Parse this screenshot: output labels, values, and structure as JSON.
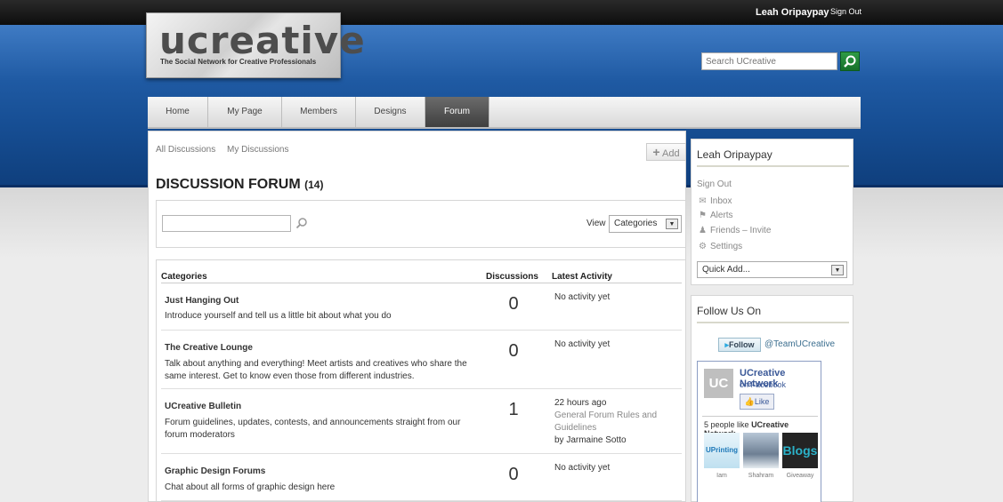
{
  "user": {
    "name": "Leah Oripaypay",
    "sign_out": "Sign Out"
  },
  "logo": {
    "wordmark": "ucreative",
    "tagline": "The Social Network for Creative Professionals"
  },
  "search": {
    "placeholder": "Search UCreative"
  },
  "nav": [
    "Home",
    "My Page",
    "Members",
    "Designs",
    "Forum"
  ],
  "nav_active": "Forum",
  "main": {
    "subnav": [
      "All Discussions",
      "My Discussions"
    ],
    "add_label": "Add",
    "title": "DISCUSSION FORUM",
    "count": "(14)",
    "view_label": "View",
    "view_value": "Categories",
    "columns": [
      "Categories",
      "Discussions",
      "Latest Activity"
    ],
    "rows": [
      {
        "name": "Just Hanging Out",
        "desc": "Introduce yourself and tell us a little bit about what you do",
        "count": "0",
        "activity": "No activity yet",
        "link": "",
        "by": ""
      },
      {
        "name": "The Creative Lounge",
        "desc": "Talk about anything and everything! Meet artists and creatives who share the same interest. Get to know even those from different industries.",
        "count": "0",
        "activity": "No activity yet",
        "link": "",
        "by": ""
      },
      {
        "name": "UCreative Bulletin",
        "desc": "Forum guidelines, updates, contests, and announcements straight from our forum moderators",
        "count": "1",
        "activity": "22 hours ago",
        "link": "General Forum Rules and Guidelines",
        "by": "by Jarmaine Sotto"
      },
      {
        "name": "Graphic Design Forums",
        "desc": "Chat about all forms of graphic design here",
        "count": "0",
        "activity": "No activity yet",
        "link": "",
        "by": ""
      }
    ]
  },
  "sidebar": {
    "user_name": "Leah Oripaypay",
    "sign_out": "Sign Out",
    "inbox": "Inbox",
    "alerts": "Alerts",
    "friends": "Friends",
    "friends_sep": "–",
    "invite": "Invite",
    "settings": "Settings",
    "quick_add": "Quick Add...",
    "follow_title": "Follow Us On",
    "twitter_button": "Follow",
    "twitter_handle": "@TeamUCreative",
    "facebook": {
      "page_name": "UCreative Network",
      "platform": "on Facebook",
      "like_label": "Like",
      "logo_text": "UC",
      "likes_text": "5 people like",
      "likes_name": "UCreative Network.",
      "fans": [
        {
          "name": "Iam",
          "thumb_text": "UPrinting"
        },
        {
          "name": "Shahram",
          "thumb_text": ""
        },
        {
          "name": "Giveaway",
          "thumb_text": "Blogs"
        }
      ]
    }
  },
  "colors": {
    "header_blue": "#1f5aa3",
    "search_green": "#16702a",
    "facebook_blue": "#3b5998",
    "active_tab": "#4a4a4a"
  }
}
